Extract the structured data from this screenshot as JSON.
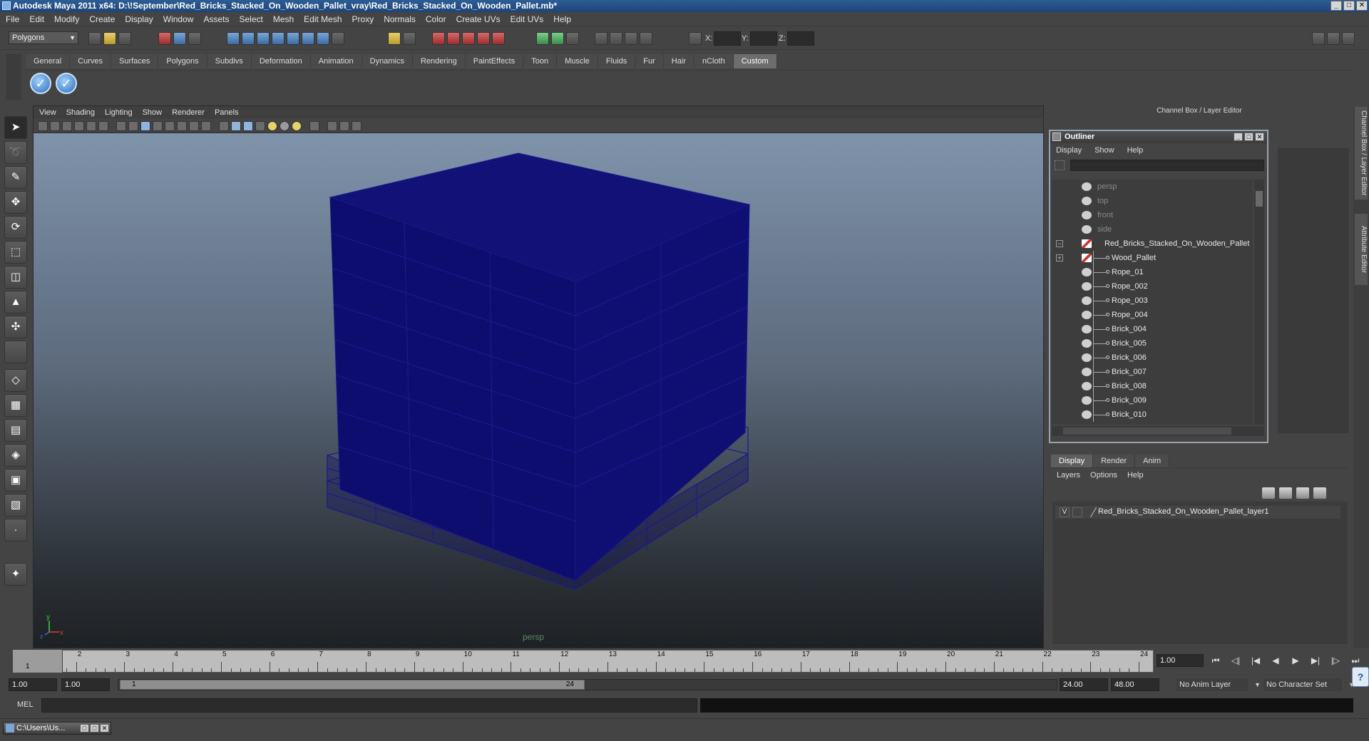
{
  "window": {
    "title": "Autodesk Maya 2011 x64: D:\\!September\\Red_Bricks_Stacked_On_Wooden_Pallet_vray\\Red_Bricks_Stacked_On_Wooden_Pallet.mb*",
    "min": "_",
    "max": "□",
    "close": "✕"
  },
  "menubar": [
    "File",
    "Edit",
    "Modify",
    "Create",
    "Display",
    "Window",
    "Assets",
    "Select",
    "Mesh",
    "Edit Mesh",
    "Proxy",
    "Normals",
    "Color",
    "Create UVs",
    "Edit UVs",
    "Help"
  ],
  "statusline": {
    "mode": "Polygons",
    "x_label": "X:",
    "y_label": "Y:",
    "z_label": "Z:"
  },
  "shelf": {
    "tabs": [
      "General",
      "Curves",
      "Surfaces",
      "Polygons",
      "Subdivs",
      "Deformation",
      "Animation",
      "Dynamics",
      "Rendering",
      "PaintEffects",
      "Toon",
      "Muscle",
      "Fluids",
      "Fur",
      "Hair",
      "nCloth",
      "Custom"
    ],
    "active_tab": "Custom",
    "button_glyph": "✓"
  },
  "viewport": {
    "menu": [
      "View",
      "Shading",
      "Lighting",
      "Show",
      "Renderer",
      "Panels"
    ],
    "camera": "persp",
    "axis_y": "y",
    "axis_x": "x",
    "axis_z": "z",
    "wire_color": "#1a1a7a"
  },
  "channel_box": {
    "title": "Channel Box / Layer Editor",
    "side_tab_1": "Channel Box / Layer Editor",
    "side_tab_2": "Attribute Editor"
  },
  "outliner": {
    "title": "Outliner",
    "menu": [
      "Display",
      "Show",
      "Help"
    ],
    "cameras": [
      "persp",
      "top",
      "front",
      "side"
    ],
    "root": "Red_Bricks_Stacked_On_Wooden_Pallet",
    "children": [
      "Wood_Pallet",
      "Rope_01",
      "Rope_002",
      "Rope_003",
      "Rope_004",
      "Brick_004",
      "Brick_005",
      "Brick_006",
      "Brick_007",
      "Brick_008",
      "Brick_009",
      "Brick_010"
    ],
    "collapse_glyph": "−",
    "expand_glyph": "+"
  },
  "layer_editor": {
    "tabs": [
      "Display",
      "Render",
      "Anim"
    ],
    "active_tab": "Display",
    "menu": [
      "Layers",
      "Options",
      "Help"
    ],
    "layer_visible": "V",
    "layer_name": "Red_Bricks_Stacked_On_Wooden_Pallet_layer1"
  },
  "timeline": {
    "start": 1,
    "end": 24,
    "current": 1,
    "current_field": "1.00"
  },
  "range": {
    "anim_start": "1.00",
    "play_start": "1.00",
    "handle_start": "1",
    "handle_end": "24",
    "play_end": "24.00",
    "anim_end": "48.00",
    "anim_layer": "No Anim Layer",
    "char_set": "No Character Set"
  },
  "command_line": {
    "label": "MEL"
  },
  "taskbar": {
    "item": "C:\\Users\\Us..."
  }
}
